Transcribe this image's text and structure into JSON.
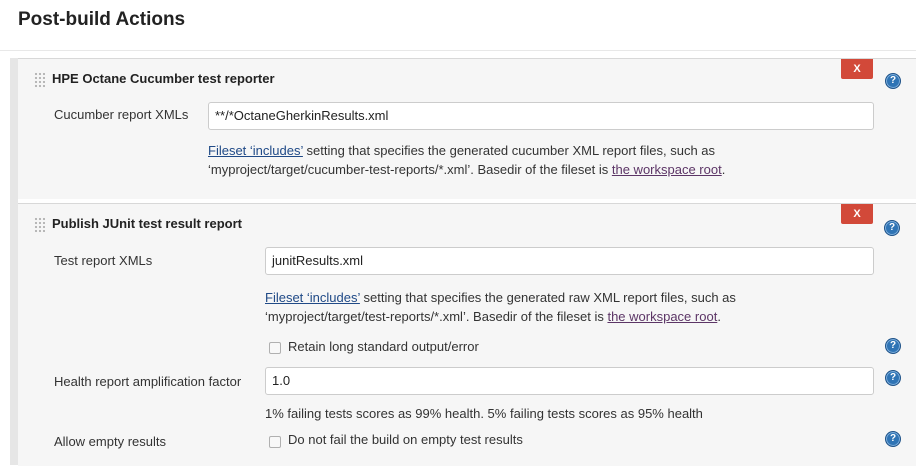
{
  "section": {
    "title": "Post-build Actions"
  },
  "icons": {
    "help": "question-mark-help-icon",
    "grip": "drag-handle-icon"
  },
  "colors": {
    "remove_button": "#d24939",
    "help_icon": "#2f74b5",
    "link": "#204a87",
    "visited_link": "#5c3566"
  },
  "cucumber": {
    "title": "HPE Octane Cucumber test reporter",
    "remove_label": "X",
    "field_label": "Cucumber report XMLs",
    "field_value": "**/*OctaneGherkinResults.xml",
    "desc_link": "Fileset ‘includes’",
    "desc_text1": " setting that specifies the generated cucumber XML report files, such as",
    "desc_text2": "‘myproject/target/cucumber-test-reports/*.xml’. Basedir of the fileset is ",
    "desc_link2": "the workspace root",
    "desc_end": "."
  },
  "junit": {
    "title": "Publish JUnit test result report",
    "remove_label": "X",
    "field_label": "Test report XMLs",
    "field_value": "junitResults.xml",
    "desc_link": "Fileset ‘includes’",
    "desc_text1": " setting that specifies the generated raw XML report files, such as",
    "desc_text2": "‘myproject/target/test-reports/*.xml’. Basedir of the fileset is ",
    "desc_link2": "the workspace root",
    "desc_end": ".",
    "retain_label": "Retain long standard output/error",
    "retain_checked": false,
    "health_label": "Health report amplification factor",
    "health_value": "1.0",
    "health_desc": "1% failing tests scores as 99% health. 5% failing tests scores as 95% health",
    "empty_label": "Allow empty results",
    "empty_checkbox_label": "Do not fail the build on empty test results",
    "empty_checked": false
  }
}
